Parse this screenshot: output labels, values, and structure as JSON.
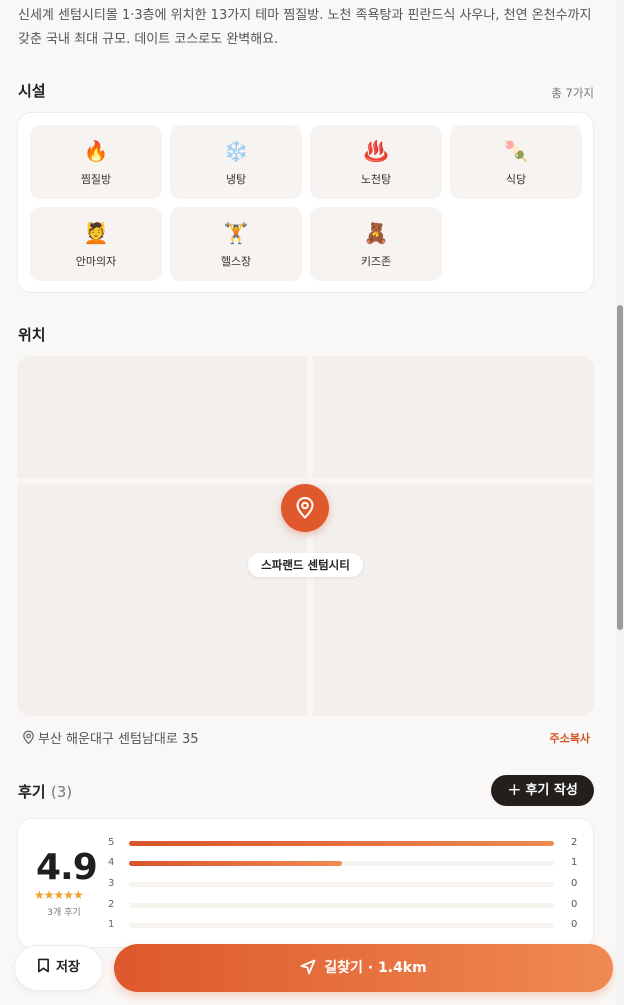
{
  "description": "신세계 센텀시티몰 1·3층에 위치한 13가지 테마 찜질방. 노천 족욕탕과 핀란드식 사우나, 천연 온천수까지 갖춘 국내 최대 규모. 데이트 코스로도 완벽해요.",
  "facilities": {
    "title": "시설",
    "total": "총 7가지",
    "items": [
      {
        "label": "찜질방",
        "icon": "🔥",
        "icon_name": "fire-icon"
      },
      {
        "label": "냉탕",
        "icon": "❄️",
        "icon_name": "snowflake-icon"
      },
      {
        "label": "노천탕",
        "icon": "♨️",
        "icon_name": "hot-springs-icon"
      },
      {
        "label": "식당",
        "icon": "🍡",
        "icon_name": "food-icon"
      },
      {
        "label": "안마의자",
        "icon": "💆",
        "icon_name": "massage-icon"
      },
      {
        "label": "헬스장",
        "icon": "🏋️",
        "icon_name": "weightlifting-icon"
      },
      {
        "label": "키즈존",
        "icon": "🧸",
        "icon_name": "teddy-bear-icon"
      }
    ]
  },
  "location": {
    "title": "위치",
    "place_name": "스파랜드 센텀시티",
    "address": "부산 해운대구 센텀남대로 35",
    "copy_label": "주소복사"
  },
  "reviews": {
    "title": "후기",
    "count": "(3)",
    "write_label": "후기 작성",
    "average": "4.9",
    "stars": "★★★★★",
    "review_count_label": "3개 후기",
    "distribution": [
      {
        "stars": "5",
        "count": "2",
        "fraction": 1.0
      },
      {
        "stars": "4",
        "count": "1",
        "fraction": 0.5
      },
      {
        "stars": "3",
        "count": "0",
        "fraction": 0
      },
      {
        "stars": "2",
        "count": "0",
        "fraction": 0
      },
      {
        "stars": "1",
        "count": "0",
        "fraction": 0
      }
    ]
  },
  "actions": {
    "save_label": "저장",
    "directions_label": "길찾기 · 1.4km"
  },
  "colors": {
    "accent": "#e0592d",
    "dark_button": "#221f1d",
    "star": "#f0a02a"
  }
}
